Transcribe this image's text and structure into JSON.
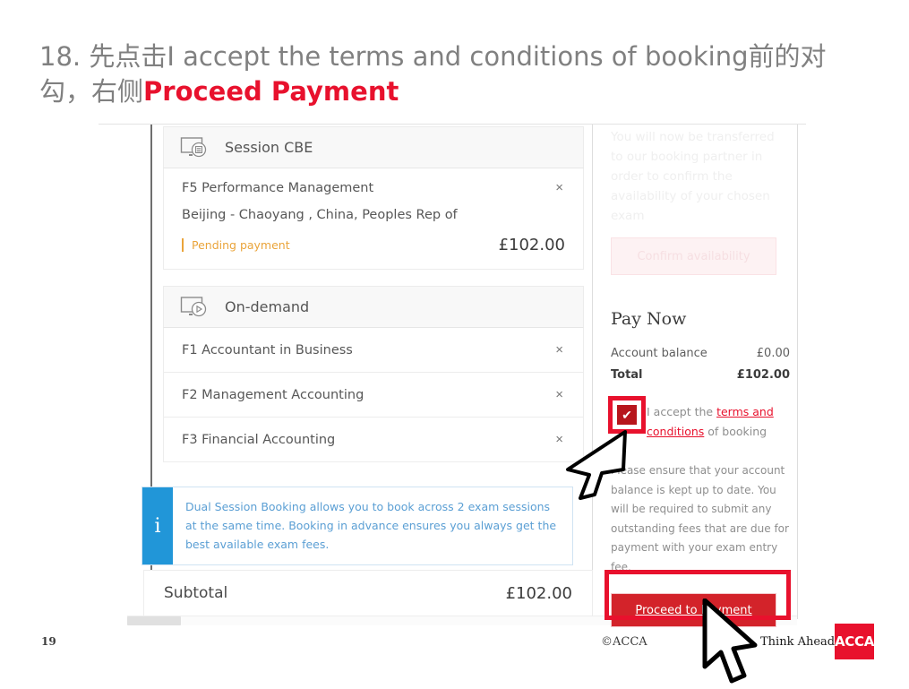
{
  "slide": {
    "title_part1": "18. 先点击I accept the terms and conditions of booking前的对",
    "title_part2": "勾，右侧",
    "title_emphasis": "Proceed Payment",
    "page_number": "19",
    "copyright": "©ACCA",
    "tagline": "Think Ahead",
    "logo_text": "ACCA",
    "brand_red": "#e8112d"
  },
  "screenshot": {
    "ghost_top_text": "",
    "cart": {
      "groups": [
        {
          "icon": "monitor-session-icon",
          "label": "Session CBE",
          "exams": [
            {
              "name": "F5 Performance Management",
              "remove": "×",
              "location": "Beijing - Chaoyang , China, Peoples Rep of",
              "status": "Pending payment",
              "status_color": "#eaa43a",
              "amount": "£102.00"
            }
          ]
        },
        {
          "icon": "monitor-ondemand-icon",
          "label": "On-demand",
          "rows": [
            {
              "name": "F1 Accountant in Business",
              "remove": "×"
            },
            {
              "name": "F2 Management Accounting",
              "remove": "×"
            },
            {
              "name": "F3 Financial Accounting",
              "remove": "×"
            }
          ]
        }
      ],
      "info_banner": {
        "icon": "info-icon",
        "icon_glyph": "i",
        "text": "Dual Session Booking allows you to book across 2 exam sessions at the same time. Booking in advance ensures you always get the best available exam fees.",
        "accent": "#2196d8"
      },
      "subtotal": {
        "label": "Subtotal",
        "amount": "£102.00"
      }
    },
    "right_panel": {
      "transfer_notice": "You will now be transferred to our booking partner in order to confirm the availability of your chosen exam",
      "confirm_button": "Confirm availability",
      "pay_now_title": "Pay Now",
      "lines": [
        {
          "label": "Account balance",
          "value": "£0.00"
        },
        {
          "label": "Total",
          "value": "£102.00"
        }
      ],
      "accept": {
        "checkbox_checked": true,
        "checkbox_glyph": "✔",
        "prefix": "I accept the ",
        "link": "terms and conditions",
        "suffix": " of booking"
      },
      "ensure_text": "Please ensure that your account balance is kept up to date. You will be required to submit any outstanding fees that are due for payment with your exam entry fee.",
      "proceed_button": "Proceed to Payment"
    }
  }
}
